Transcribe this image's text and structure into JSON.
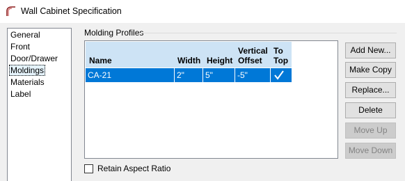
{
  "window": {
    "title": "Wall Cabinet Specification",
    "icon": "cabinet-arch-icon"
  },
  "sidebar": {
    "items": [
      {
        "label": "General"
      },
      {
        "label": "Front"
      },
      {
        "label": "Door/Drawer"
      },
      {
        "label": "Moldings",
        "selected": true
      },
      {
        "label": "Materials"
      },
      {
        "label": "Label"
      }
    ]
  },
  "molding_profiles": {
    "group_label": "Molding Profiles",
    "columns": {
      "name": "Name",
      "width": "Width",
      "height": "Height",
      "vertical_offset_1": "Vertical",
      "vertical_offset_2": "Offset",
      "to_top_1": "To",
      "to_top_2": "Top"
    },
    "rows": [
      {
        "name": "CA-21",
        "width": "2\"",
        "height": "5\"",
        "vertical_offset": "-5\"",
        "to_top": "checked"
      }
    ],
    "selection_color": "#0078d7",
    "header_color": "#cde3f5"
  },
  "buttons": {
    "add_new": "Add New...",
    "make_copy": "Make Copy",
    "replace": "Replace...",
    "delete": "Delete",
    "move_up": "Move Up",
    "move_down": "Move Down"
  },
  "options": {
    "retain_aspect_ratio": "Retain Aspect Ratio"
  }
}
